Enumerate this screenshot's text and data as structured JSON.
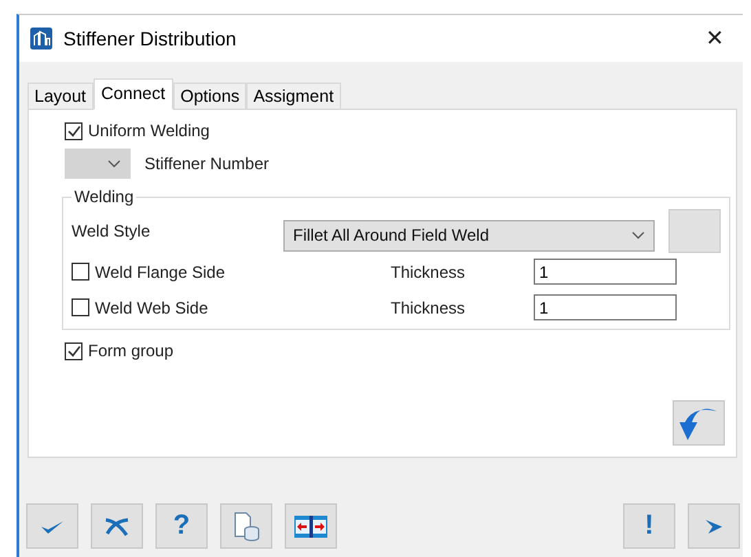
{
  "window": {
    "title": "Stiffener Distribution",
    "close": "✕"
  },
  "tabs": [
    {
      "label": "Layout",
      "selected": false
    },
    {
      "label": "Connect",
      "selected": true
    },
    {
      "label": "Options",
      "selected": false
    },
    {
      "label": "Assigment",
      "selected": false
    }
  ],
  "uniform_welding": {
    "label": "Uniform Welding",
    "checked": true
  },
  "stiffener_number": {
    "label": "Stiffener Number",
    "disabled": true
  },
  "welding": {
    "title": "Welding",
    "weld_style_label": "Weld Style",
    "weld_style": "Fillet All Around Field Weld",
    "rows": [
      {
        "label": "Weld Flange Side",
        "checked": false,
        "thickness_label": "Thickness",
        "thickness": "1"
      },
      {
        "label": "Weld Web Side",
        "checked": false,
        "thickness_label": "Thickness",
        "thickness": "1"
      }
    ]
  },
  "form_group": {
    "label": "Form group",
    "checked": true
  },
  "bottom_buttons": [
    {
      "kind": "ok"
    },
    {
      "kind": "cancel"
    },
    {
      "kind": "help",
      "label": "?"
    },
    {
      "kind": "copy"
    },
    {
      "kind": "split"
    }
  ],
  "right_buttons": [
    {
      "kind": "warn",
      "label": "!"
    },
    {
      "kind": "next"
    }
  ]
}
